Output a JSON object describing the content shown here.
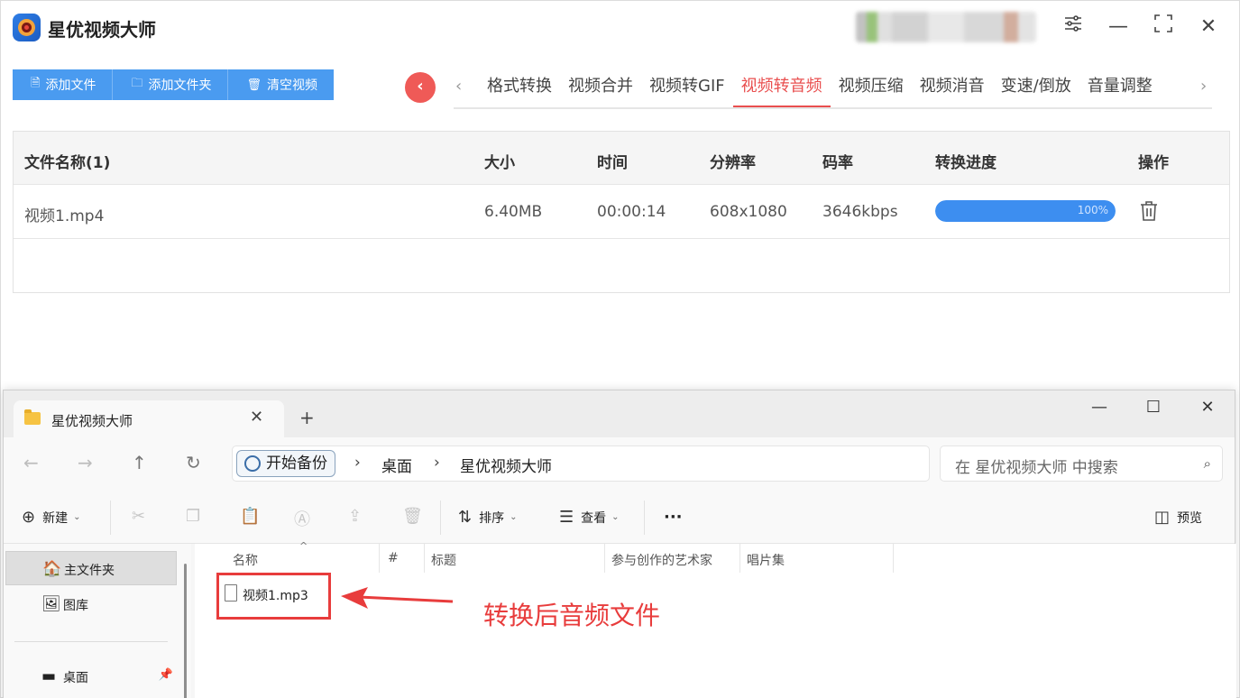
{
  "app": {
    "title": "星优视频大师",
    "buttons": {
      "add_file": "添加文件",
      "add_folder": "添加文件夹",
      "clear": "清空视频"
    },
    "tabs": [
      {
        "label": "格式转换",
        "active": false
      },
      {
        "label": "视频合并",
        "active": false
      },
      {
        "label": "视频转GIF",
        "active": false
      },
      {
        "label": "视频转音频",
        "active": true
      },
      {
        "label": "视频压缩",
        "active": false
      },
      {
        "label": "视频消音",
        "active": false
      },
      {
        "label": "变速/倒放",
        "active": false
      },
      {
        "label": "音量调整",
        "active": false
      }
    ],
    "accent_color": "#e94f4f",
    "table": {
      "headers": [
        "文件名称(1)",
        "大小",
        "时间",
        "分辨率",
        "码率",
        "转换进度",
        "操作"
      ],
      "rows": [
        {
          "name": "视频1.mp4",
          "size": "6.40MB",
          "time": "00:00:14",
          "resolution": "608x1080",
          "bitrate": "3646kbps",
          "progress": 1.0,
          "progress_text": "100%"
        }
      ]
    }
  },
  "explorer": {
    "tab_title": "星优视频大师",
    "address": {
      "backup": "开始备份",
      "crumbs": [
        "桌面",
        "星优视频大师"
      ]
    },
    "search_placeholder": "在 星优视频大师 中搜索",
    "commands": {
      "new": "新建",
      "sort": "排序",
      "view": "查看",
      "more": "···",
      "preview": "预览"
    },
    "sidebar": [
      {
        "label": "主文件夹",
        "icon": "home-icon",
        "selected": true
      },
      {
        "label": "图库",
        "icon": "gallery-icon",
        "selected": false
      },
      {
        "label": "桌面",
        "icon": "desktop-icon",
        "selected": false
      }
    ],
    "columns": [
      "名称",
      "#",
      "标题",
      "参与创作的艺术家",
      "唱片集"
    ],
    "files": [
      {
        "name": "视频1.mp3"
      }
    ],
    "annotation": "转换后音频文件"
  }
}
